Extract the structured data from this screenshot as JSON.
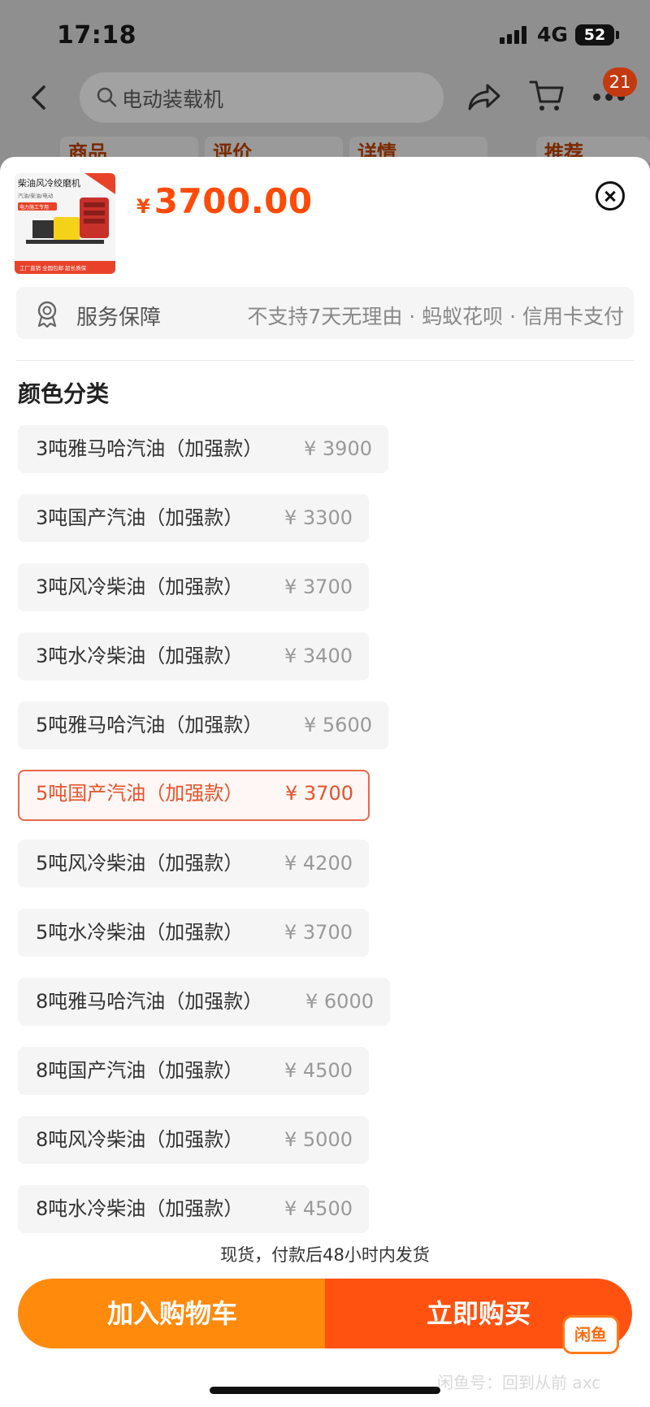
{
  "status_bar": {
    "time": "17:18",
    "network": "4G",
    "battery": "52"
  },
  "header": {
    "search_text": "电动装载机",
    "cart_badge": "21"
  },
  "background_tabs": [
    "商品",
    "评价",
    "详情",
    "推荐"
  ],
  "product": {
    "thumb_title": "柴油风冷绞磨机",
    "thumb_sub": "汽油/柴油/电动",
    "thumb_tag": "电力施工专用",
    "thumb_footer": "工厂直销 全国包邮 超长质保",
    "currency": "¥",
    "price": "3700.00"
  },
  "service": {
    "label": "服务保障",
    "text": "不支持7天无理由 · 蚂蚁花呗 · 信用卡支付"
  },
  "options_title": "颜色分类",
  "options": [
    {
      "name": "3吨雅马哈汽油（加强款）",
      "price": "¥ 3900"
    },
    {
      "name": "3吨国产汽油（加强款）",
      "price": "¥ 3300"
    },
    {
      "name": "3吨风冷柴油（加强款）",
      "price": "¥ 3700"
    },
    {
      "name": "3吨水冷柴油（加强款）",
      "price": "¥ 3400"
    },
    {
      "name": "5吨雅马哈汽油（加强款）",
      "price": "¥ 5600"
    },
    {
      "name": "5吨国产汽油（加强款）",
      "price": "¥ 3700"
    },
    {
      "name": "5吨风冷柴油（加强款）",
      "price": "¥ 4200"
    },
    {
      "name": "5吨水冷柴油（加强款）",
      "price": "¥ 3700"
    },
    {
      "name": "8吨雅马哈汽油（加强款）",
      "price": "¥ 6000"
    },
    {
      "name": "8吨国产汽油（加强款）",
      "price": "¥ 4500"
    },
    {
      "name": "8吨风冷柴油（加强款）",
      "price": "¥ 5000"
    },
    {
      "name": "8吨水冷柴油（加强款）",
      "price": "¥ 4500"
    }
  ],
  "selected_option": "5吨国产汽油（加强款）",
  "shipping_note": "现货，付款后48小时内发货",
  "buttons": {
    "add_to_cart": "加入购物车",
    "buy_now": "立即购买"
  },
  "watermark": {
    "logo": "闲鱼",
    "text": "闲鱼号：回到从前 axc"
  },
  "colors": {
    "accent": "#ff4b07",
    "cart_button": "#ff8a0c",
    "buy_button": "#ff5210",
    "selected_border": "#e7694a"
  }
}
